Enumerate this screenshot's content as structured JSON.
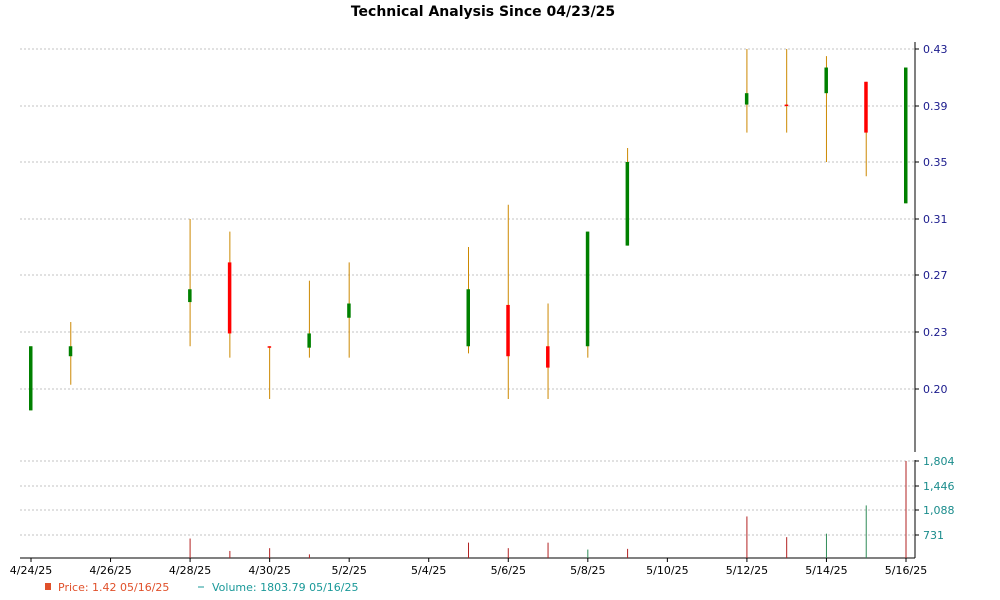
{
  "chart_data": {
    "type": "candlestick",
    "title": "Technical Analysis Since 04/23/25",
    "colors": {
      "up": "#008000",
      "down": "#ff0000",
      "wick": "#cc8800",
      "grid": "#b0b0b0",
      "volume_up": "#2e8b57",
      "volume_down": "#b22222",
      "y_tick_text": "#1a1a8c",
      "vol_tick_text": "#1a8c8c",
      "price_legend": "#e0502a",
      "volume_legend": "#1a9999"
    },
    "x_ticks": [
      "4/24/25",
      "4/26/25",
      "4/28/25",
      "4/30/25",
      "5/2/25",
      "5/4/25",
      "5/6/25",
      "5/8/25",
      "5/10/25",
      "5/12/25",
      "5/14/25",
      "5/16/25"
    ],
    "x_tick_days": [
      0,
      2,
      4,
      6,
      8,
      10,
      12,
      14,
      16,
      18,
      20,
      22
    ],
    "x_range_days": [
      0,
      22
    ],
    "price_axis": {
      "ticks": [
        "0.43",
        "0.39",
        "0.35",
        "0.31",
        "0.27",
        "0.23",
        "0.20"
      ],
      "tick_values": [
        0.43,
        0.39,
        0.35,
        0.31,
        0.27,
        0.23,
        0.19
      ],
      "range": [
        0.165,
        0.43
      ]
    },
    "volume_axis": {
      "ticks": [
        "1,804",
        "1,446",
        "1,088",
        "731"
      ],
      "tick_values": [
        1804,
        1446,
        1088,
        731
      ],
      "range": [
        400,
        1804
      ]
    },
    "candles": [
      {
        "date": "4/24/25",
        "day": 0,
        "open": 0.175,
        "high": 0.22,
        "low": 0.175,
        "close": 0.22
      },
      {
        "date": "4/25/25",
        "day": 1,
        "open": 0.213,
        "high": 0.237,
        "low": 0.193,
        "close": 0.22
      },
      {
        "date": "4/28/25",
        "day": 4,
        "open": 0.251,
        "high": 0.31,
        "low": 0.22,
        "close": 0.26
      },
      {
        "date": "4/29/25",
        "day": 5,
        "open": 0.279,
        "high": 0.301,
        "low": 0.212,
        "close": 0.229
      },
      {
        "date": "4/30/25",
        "day": 6,
        "open": 0.22,
        "high": 0.22,
        "low": 0.183,
        "close": 0.22
      },
      {
        "date": "5/1/25",
        "day": 7,
        "open": 0.219,
        "high": 0.266,
        "low": 0.212,
        "close": 0.229
      },
      {
        "date": "5/2/25",
        "day": 8,
        "open": 0.24,
        "high": 0.279,
        "low": 0.212,
        "close": 0.25
      },
      {
        "date": "5/5/25",
        "day": 11,
        "open": 0.22,
        "high": 0.29,
        "low": 0.215,
        "close": 0.26
      },
      {
        "date": "5/6/25",
        "day": 12,
        "open": 0.249,
        "high": 0.32,
        "low": 0.183,
        "close": 0.213
      },
      {
        "date": "5/7/25",
        "day": 13,
        "open": 0.22,
        "high": 0.25,
        "low": 0.183,
        "close": 0.205
      },
      {
        "date": "5/8/25",
        "day": 14,
        "open": 0.22,
        "high": 0.301,
        "low": 0.212,
        "close": 0.301
      },
      {
        "date": "5/9/25",
        "day": 15,
        "open": 0.291,
        "high": 0.36,
        "low": 0.291,
        "close": 0.35
      },
      {
        "date": "5/12/25",
        "day": 18,
        "open": 0.391,
        "high": 0.43,
        "low": 0.371,
        "close": 0.399
      },
      {
        "date": "5/13/25",
        "day": 19,
        "open": 0.39,
        "high": 0.43,
        "low": 0.371,
        "close": 0.391
      },
      {
        "date": "5/14/25",
        "day": 20,
        "open": 0.399,
        "high": 0.425,
        "low": 0.35,
        "close": 0.417
      },
      {
        "date": "5/15/25",
        "day": 21,
        "open": 0.407,
        "high": 0.407,
        "low": 0.34,
        "close": 0.371
      },
      {
        "date": "5/16/25",
        "day": 22,
        "open": 0.321,
        "high": 0.417,
        "low": 0.321,
        "close": 0.417
      }
    ],
    "volume": [
      {
        "day": 4,
        "value": 680,
        "dir": "down"
      },
      {
        "day": 5,
        "value": 500,
        "dir": "down"
      },
      {
        "day": 6,
        "value": 540,
        "dir": "down"
      },
      {
        "day": 7,
        "value": 450,
        "dir": "down"
      },
      {
        "day": 11,
        "value": 620,
        "dir": "down"
      },
      {
        "day": 12,
        "value": 540,
        "dir": "down"
      },
      {
        "day": 13,
        "value": 620,
        "dir": "down"
      },
      {
        "day": 14,
        "value": 520,
        "dir": "up"
      },
      {
        "day": 15,
        "value": 530,
        "dir": "down"
      },
      {
        "day": 18,
        "value": 1000,
        "dir": "down"
      },
      {
        "day": 19,
        "value": 700,
        "dir": "down"
      },
      {
        "day": 20,
        "value": 750,
        "dir": "up"
      },
      {
        "day": 21,
        "value": 1160,
        "dir": "up"
      },
      {
        "day": 22,
        "value": 1804,
        "dir": "down"
      }
    ],
    "legend": {
      "price": "Price: 1.42  05/16/25",
      "volume": "Volume: 1803.79  05/16/25"
    }
  }
}
